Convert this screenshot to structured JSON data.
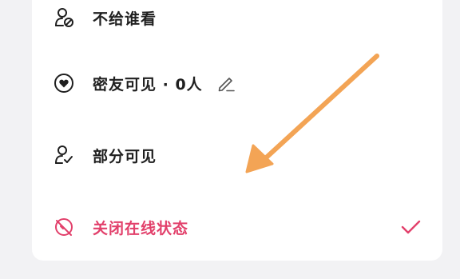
{
  "theme": {
    "accent": "#e2406b",
    "text": "#1f1f1f",
    "arrow": "#f3a455",
    "background": "#f2f2f4",
    "card": "#ffffff"
  },
  "options": [
    {
      "label": "不给谁看",
      "icon": "user-block-icon",
      "selected": false
    },
    {
      "label": "密友可见 · 0人",
      "icon": "heart-circle-icon",
      "selected": false,
      "extra_icon": "pencil-edit-icon"
    },
    {
      "label": "部分可见",
      "icon": "user-check-icon",
      "selected": false
    },
    {
      "label": "关闭在线状态",
      "icon": "offline-icon",
      "selected": true
    }
  ],
  "selected_indicator_icon": "checkmark-icon",
  "annotation_icon": "orange-arrow"
}
